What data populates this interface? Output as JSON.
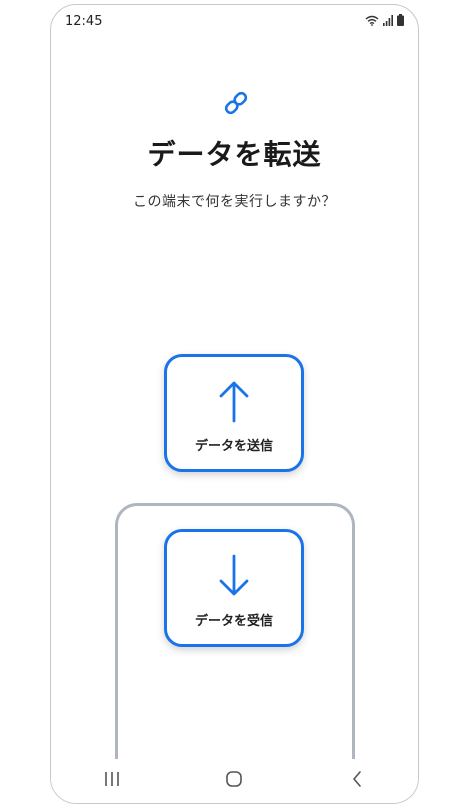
{
  "status_bar": {
    "time": "12:45",
    "icons": [
      "wifi-icon",
      "signal-icon",
      "battery-icon"
    ]
  },
  "header": {
    "icon": "link-icon",
    "title": "データを転送",
    "subtitle": "この端末で何を実行しますか？"
  },
  "actions": {
    "send": {
      "icon": "arrow-up-icon",
      "label": "データを送信"
    },
    "receive": {
      "icon": "arrow-down-icon",
      "label": "データを受信"
    }
  },
  "nav_bar": {
    "buttons": [
      "recent-apps-icon",
      "home-icon",
      "back-icon"
    ]
  },
  "colors": {
    "accent": "#1a73e8",
    "frame": "#aeb6bf"
  }
}
